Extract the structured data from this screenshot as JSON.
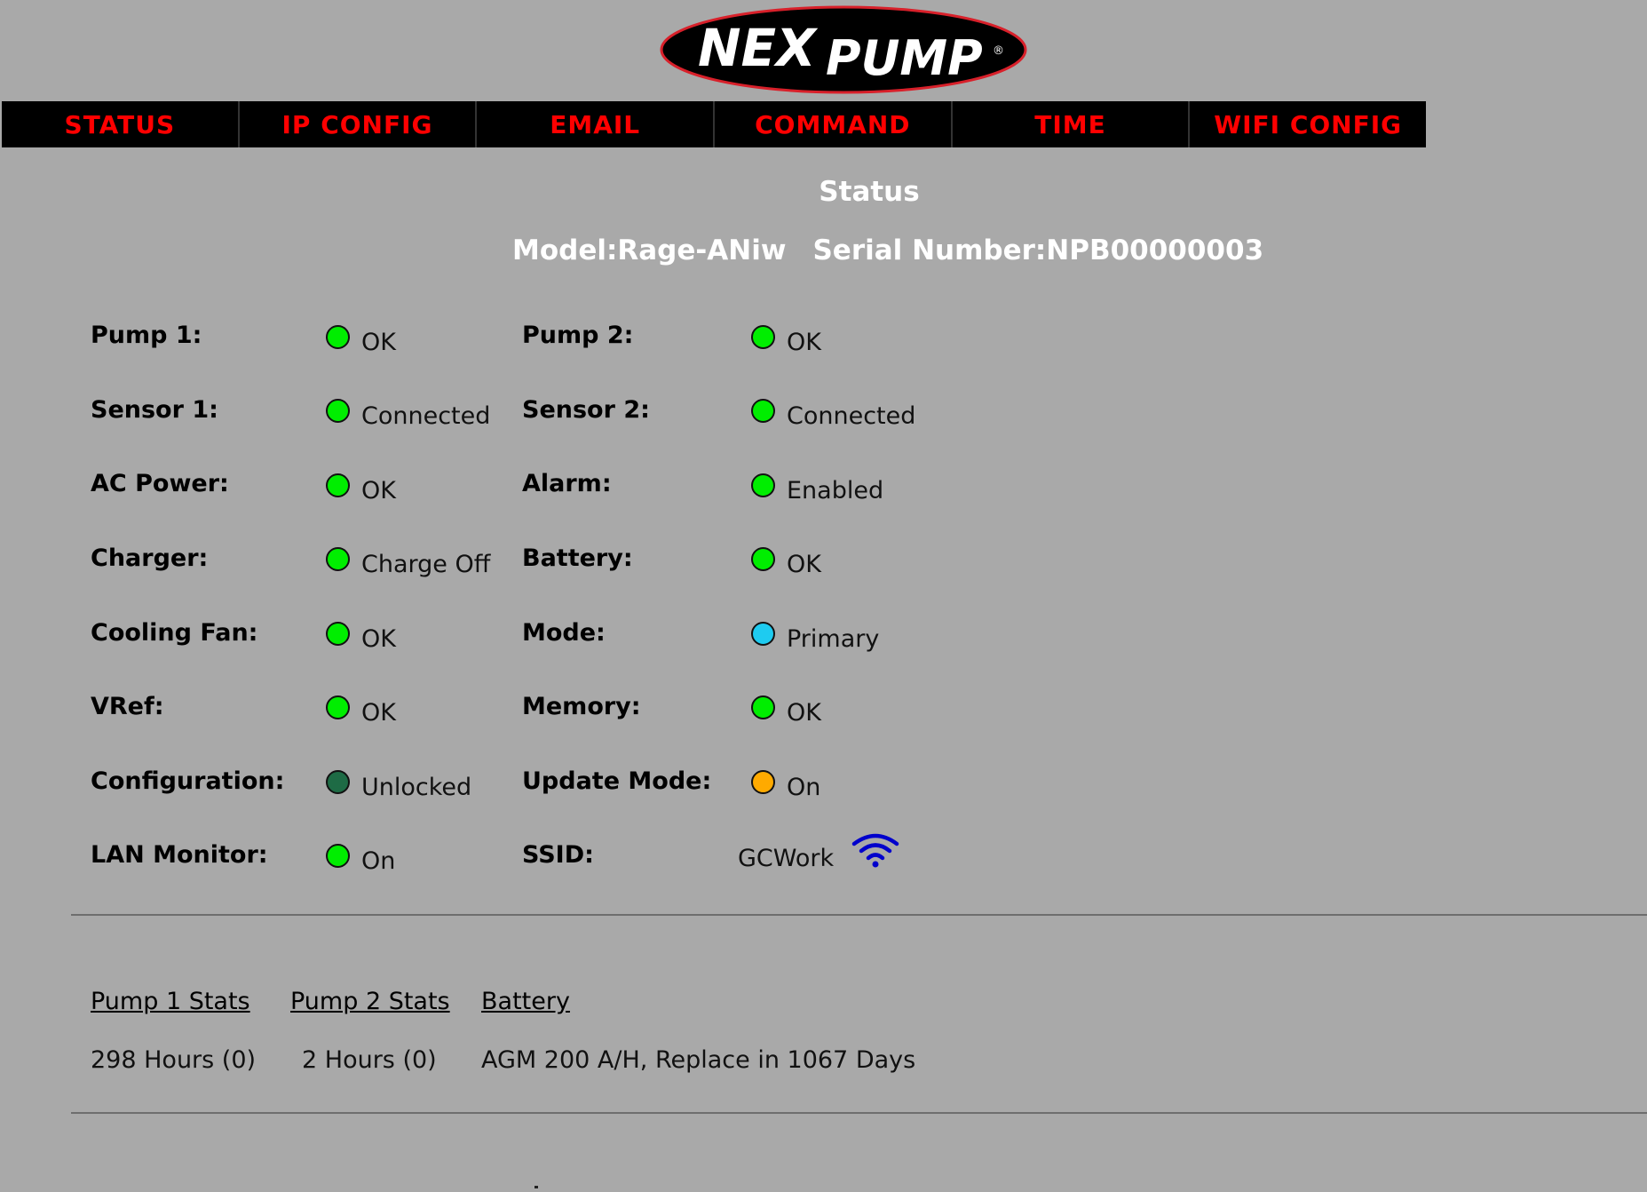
{
  "brand": {
    "logo_text_1": "NEX",
    "logo_text_2": "PUMP",
    "logo_mark": "®"
  },
  "nav": {
    "items": [
      {
        "label": "STATUS"
      },
      {
        "label": "IP CONFIG"
      },
      {
        "label": "EMAIL"
      },
      {
        "label": "COMMAND"
      },
      {
        "label": "TIME"
      },
      {
        "label": "WIFI CONFIG"
      }
    ],
    "color": "#ff0000",
    "background": "#000000"
  },
  "page": {
    "title": "Status",
    "model": "Model:Rage-ANiw",
    "serial": "Serial Number:NPB00000003"
  },
  "status_colors": {
    "green": "#00ee00",
    "dark_green": "#1e6b45",
    "cyan": "#1ecbf0",
    "orange": "#ffaa00"
  },
  "status": {
    "pump1": {
      "label": "Pump 1:",
      "value": "OK",
      "indicator": "green"
    },
    "pump2": {
      "label": "Pump 2:",
      "value": "OK",
      "indicator": "green"
    },
    "sensor1": {
      "label": "Sensor 1:",
      "value": "Connected",
      "indicator": "green"
    },
    "sensor2": {
      "label": "Sensor 2:",
      "value": "Connected",
      "indicator": "green"
    },
    "ac_power": {
      "label": "AC Power:",
      "value": "OK",
      "indicator": "green"
    },
    "alarm": {
      "label": "Alarm:",
      "value": "Enabled",
      "indicator": "green"
    },
    "charger": {
      "label": "Charger:",
      "value": "Charge Off",
      "indicator": "green"
    },
    "battery": {
      "label": "Battery:",
      "value": "OK",
      "indicator": "green"
    },
    "cooling_fan": {
      "label": "Cooling Fan:",
      "value": "OK",
      "indicator": "green"
    },
    "mode": {
      "label": "Mode:",
      "value": "Primary",
      "indicator": "cyan"
    },
    "vref": {
      "label": "VRef:",
      "value": "OK",
      "indicator": "green"
    },
    "memory": {
      "label": "Memory:",
      "value": "OK",
      "indicator": "green"
    },
    "configuration": {
      "label": "Configuration:",
      "value": "Unlocked",
      "indicator": "dark_green"
    },
    "update_mode": {
      "label": "Update Mode:",
      "value": "On",
      "indicator": "orange"
    },
    "lan_monitor": {
      "label": "LAN Monitor:",
      "value": "On",
      "indicator": "green"
    },
    "ssid": {
      "label": "SSID:",
      "value": "GCWork",
      "icon": "wifi-icon",
      "icon_color": "#0000cc"
    }
  },
  "stats": {
    "pump1_link": "Pump 1 Stats",
    "pump2_link": "Pump 2 Stats",
    "battery_link": "Battery",
    "pump1_value": "298 Hours (0)",
    "pump2_value": "2 Hours (0)",
    "battery_value": "AGM 200 A/H, Replace in 1067 Days"
  }
}
